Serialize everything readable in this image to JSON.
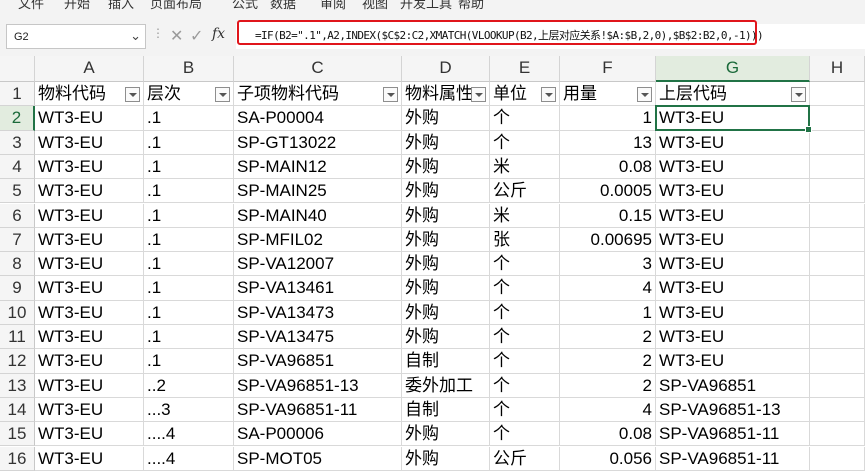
{
  "menu": {
    "items": [
      "文件",
      "开始",
      "插入",
      "页面布局",
      "公式",
      "数据",
      "审阅",
      "视图",
      "开发工具",
      "帮助"
    ]
  },
  "formula_bar": {
    "name_box": "G2",
    "formula": "=IF(B2=\".1\",A2,INDEX($C$2:C2,XMATCH(VLOOKUP(B2,上层对应关系!$A:$B,2,0),$B$2:B2,0,-1)))",
    "fx_label": "fx",
    "highlight_color": "#e0151b"
  },
  "columns": [
    "A",
    "B",
    "C",
    "D",
    "E",
    "F",
    "G",
    "H"
  ],
  "headers": [
    "物料代码",
    "层次",
    "子项物料代码",
    "物料属性",
    "单位",
    "用量",
    "上层代码"
  ],
  "row_numbers": [
    "1",
    "2",
    "3",
    "4",
    "5",
    "6",
    "7",
    "8",
    "9",
    "10",
    "11",
    "12",
    "13",
    "14",
    "15",
    "16"
  ],
  "rows": [
    [
      "WT3-EU",
      ".1",
      "SA-P00004",
      "外购",
      "个",
      "1",
      "WT3-EU"
    ],
    [
      "WT3-EU",
      ".1",
      "SP-GT13022",
      "外购",
      "个",
      "13",
      "WT3-EU"
    ],
    [
      "WT3-EU",
      ".1",
      "SP-MAIN12",
      "外购",
      "米",
      "0.08",
      "WT3-EU"
    ],
    [
      "WT3-EU",
      ".1",
      "SP-MAIN25",
      "外购",
      "公斤",
      "0.0005",
      "WT3-EU"
    ],
    [
      "WT3-EU",
      ".1",
      "SP-MAIN40",
      "外购",
      "米",
      "0.15",
      "WT3-EU"
    ],
    [
      "WT3-EU",
      ".1",
      "SP-MFIL02",
      "外购",
      "张",
      "0.00695",
      "WT3-EU"
    ],
    [
      "WT3-EU",
      ".1",
      "SP-VA12007",
      "外购",
      "个",
      "3",
      "WT3-EU"
    ],
    [
      "WT3-EU",
      ".1",
      "SP-VA13461",
      "外购",
      "个",
      "4",
      "WT3-EU"
    ],
    [
      "WT3-EU",
      ".1",
      "SP-VA13473",
      "外购",
      "个",
      "1",
      "WT3-EU"
    ],
    [
      "WT3-EU",
      ".1",
      "SP-VA13475",
      "外购",
      "个",
      "2",
      "WT3-EU"
    ],
    [
      "WT3-EU",
      ".1",
      "SP-VA96851",
      "自制",
      "个",
      "2",
      "WT3-EU"
    ],
    [
      "WT3-EU",
      "..2",
      "SP-VA96851-13",
      "委外加工",
      "个",
      "2",
      "SP-VA96851"
    ],
    [
      "WT3-EU",
      "...3",
      "SP-VA96851-11",
      "自制",
      "个",
      "4",
      "SP-VA96851-13"
    ],
    [
      "WT3-EU",
      "....4",
      "SA-P00006",
      "外购",
      "个",
      "0.08",
      "SP-VA96851-11"
    ],
    [
      "WT3-EU",
      "....4",
      "SP-MOT05",
      "外购",
      "公斤",
      "0.056",
      "SP-VA96851-11"
    ]
  ],
  "selected_cell": "G2",
  "accent_color": "#217346"
}
